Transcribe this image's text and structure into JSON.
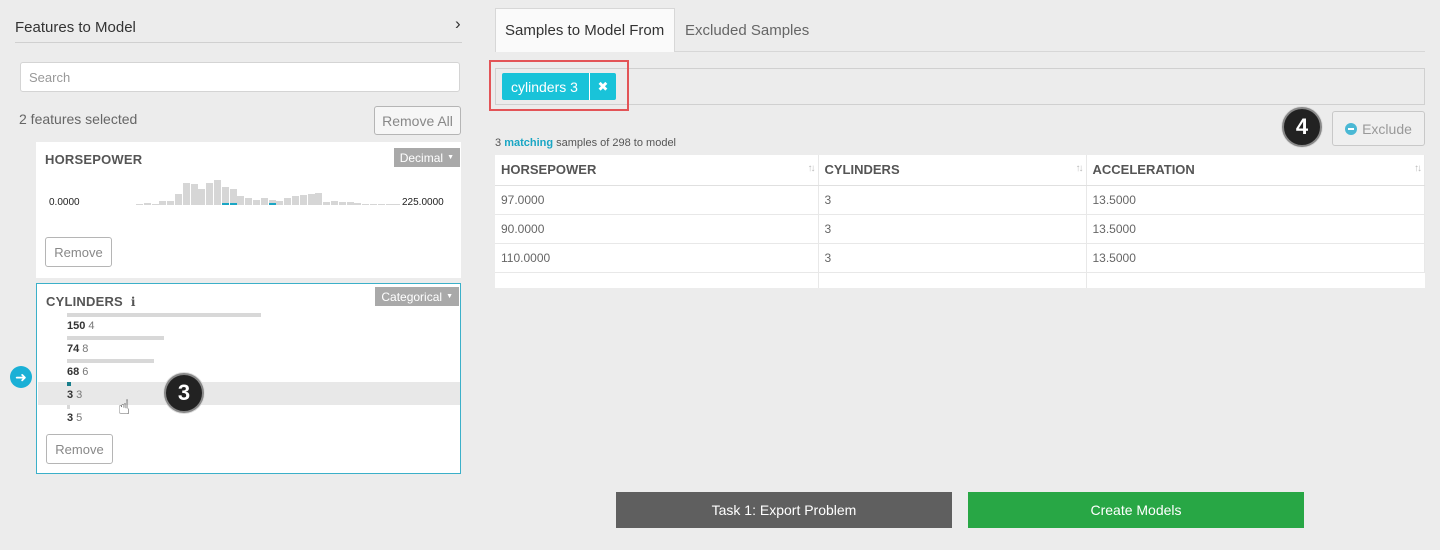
{
  "left": {
    "title": "Features to Model",
    "collapse_icon": "chevron-right-icon",
    "search_placeholder": "Search",
    "selected_count_text": "2 features selected",
    "remove_all_label": "Remove All",
    "features": [
      {
        "name": "HORSEPOWER",
        "type": "Decimal",
        "min": "0.0000",
        "max": "225.0000",
        "histogram": [
          1,
          2,
          1,
          4,
          4,
          10,
          20,
          19,
          15,
          20,
          23,
          17,
          15,
          8,
          6,
          5,
          6,
          5,
          4,
          6,
          8,
          9,
          10,
          11,
          3,
          4,
          3,
          3,
          2,
          0,
          1,
          0,
          0,
          1
        ],
        "remove_label": "Remove"
      },
      {
        "name": "CYLINDERS",
        "type": "Categorical",
        "info_icon": "info-icon",
        "categories": [
          {
            "value": "150",
            "count": "4",
            "fraction": 1.0
          },
          {
            "value": "74",
            "count": "8",
            "fraction": 0.5
          },
          {
            "value": "68",
            "count": "6",
            "fraction": 0.45
          },
          {
            "value": "3",
            "count": "3",
            "fraction": 0.02,
            "highlighted": true
          },
          {
            "value": "3",
            "count": "5",
            "fraction": 0.015
          }
        ],
        "remove_label": "Remove"
      }
    ],
    "arrow_icon": "arrow-right-circle-icon",
    "step_badge_3": "3"
  },
  "right": {
    "tabs": [
      {
        "label": "Samples to Model From",
        "active": true
      },
      {
        "label": "Excluded Samples",
        "active": false
      }
    ],
    "filter_chip": {
      "label": "cylinders 3",
      "remove_icon": "close-icon"
    },
    "step_badge_4": "4",
    "exclude_label": "Exclude",
    "matching": {
      "count": "3",
      "word": "matching",
      "rest": "samples of 298 to model"
    },
    "table": {
      "columns": [
        "HORSEPOWER",
        "CYLINDERS",
        "ACCELERATION"
      ],
      "rows": [
        [
          "97.0000",
          "3",
          "13.5000"
        ],
        [
          "90.0000",
          "3",
          "13.5000"
        ],
        [
          "110.0000",
          "3",
          "13.5000"
        ]
      ]
    }
  },
  "footer": {
    "export_label": "Task 1: Export Problem",
    "create_label": "Create Models"
  },
  "colors": {
    "accent": "#19c3d9",
    "create": "#28a745",
    "export": "#5f5f5f",
    "highlight_box": "#e35457"
  }
}
